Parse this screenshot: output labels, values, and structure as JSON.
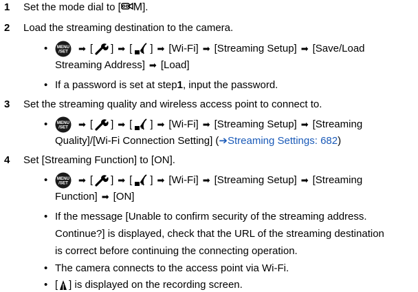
{
  "steps": [
    {
      "num": "1",
      "text_before": "Set the mode dial to [",
      "mode_label": "M",
      "text_after": "]."
    },
    {
      "num": "2",
      "text": "Load the streaming destination to the camera."
    },
    {
      "num": "3",
      "text": "Set the streaming quality and wireless access point to connect to."
    },
    {
      "num": "4",
      "text": "Set [Streaming Function] to [ON]."
    }
  ],
  "common": {
    "arrow": "➡",
    "bracket_open": "[",
    "bracket_close": "]",
    "wifi": "[Wi-Fi]",
    "streaming_setup": "[Streaming Setup]",
    "bullet": "•",
    "menu_icon_text_top": "MENU",
    "menu_icon_text_bottom": "/SET"
  },
  "step2": {
    "save_load_1": "[Save/Load",
    "save_load_2": "Streaming Address]",
    "load": "[Load]",
    "pw_before": "If a password is set at step ",
    "pw_step": "1",
    "pw_after": ", input the password."
  },
  "step3": {
    "streaming_1": "[Streaming",
    "quality": "Quality]/[Wi-Fi Connection Setting] (",
    "link_arrow": "➔",
    "link_text": "Streaming Settings: 682",
    "close_paren": ")"
  },
  "step4": {
    "streaming_1": "[Streaming",
    "function": "Function]",
    "on": "[ON]",
    "msg1": "If the message [Unable to confirm security of the streaming address.",
    "msg2": "Continue?] is displayed, check that the URL of the streaming destination",
    "msg3": "is correct before continuing the connecting operation.",
    "connects": "The camera connects to the access point via Wi-Fi.",
    "displayed_before": "[",
    "displayed_after": "] is displayed on the recording screen."
  }
}
